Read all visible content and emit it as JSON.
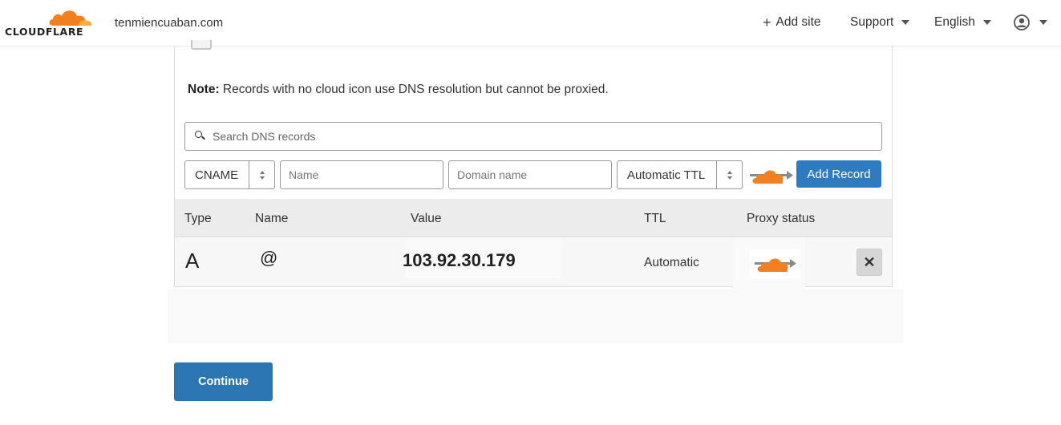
{
  "header": {
    "logo_text": "CLOUDFLARE",
    "domain": "tenmiencuaban.com",
    "add_site": "Add site",
    "support": "Support",
    "language": "English",
    "user_icon": "user-circle-icon"
  },
  "note": {
    "label": "Note:",
    "text": " Records with no cloud icon use DNS resolution but cannot be proxied."
  },
  "search": {
    "placeholder": "Search DNS records"
  },
  "add_form": {
    "type_value": "CNAME",
    "name_placeholder": "Name",
    "domain_placeholder": "Domain name",
    "ttl_value": "Automatic TTL",
    "add_button": "Add Record"
  },
  "table": {
    "headers": {
      "type": "Type",
      "name": "Name",
      "value": "Value",
      "ttl": "TTL",
      "proxy": "Proxy status"
    },
    "rows": [
      {
        "type": "A",
        "name": "@",
        "value": "103.92.30.179",
        "ttl": "Automatic",
        "delete": "✕"
      }
    ]
  },
  "continue_label": "Continue",
  "colors": {
    "brand_orange": "#f38020",
    "primary_blue": "#2f7bbf"
  }
}
